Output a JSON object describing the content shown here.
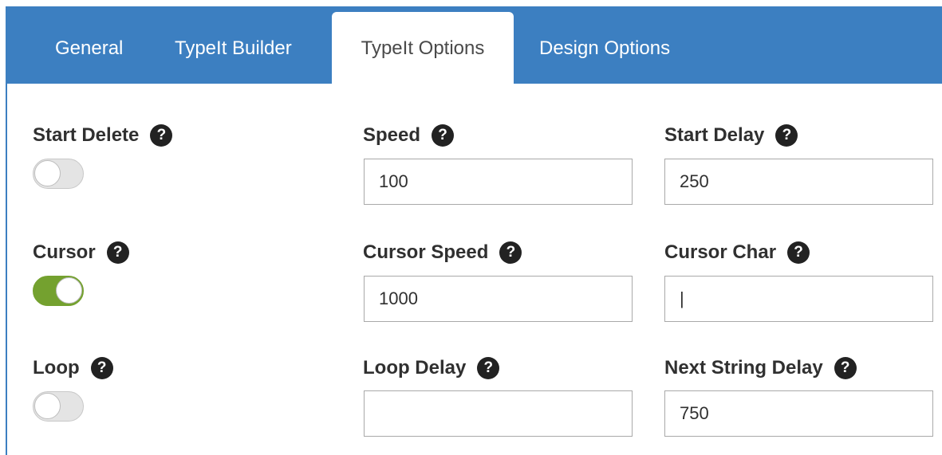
{
  "tabs": [
    {
      "label": "General"
    },
    {
      "label": "TypeIt Builder"
    },
    {
      "label": "TypeIt Options"
    },
    {
      "label": "Design Options"
    }
  ],
  "active_tab": "TypeIt Options",
  "help_glyph": "?",
  "fields": {
    "start_delete": {
      "label": "Start Delete",
      "enabled": false
    },
    "cursor": {
      "label": "Cursor",
      "enabled": true
    },
    "loop": {
      "label": "Loop",
      "enabled": false
    },
    "speed": {
      "label": "Speed",
      "value": "100"
    },
    "start_delay": {
      "label": "Start Delay",
      "value": "250"
    },
    "cursor_speed": {
      "label": "Cursor Speed",
      "value": "1000"
    },
    "cursor_char": {
      "label": "Cursor Char",
      "value": "|"
    },
    "loop_delay": {
      "label": "Loop Delay",
      "value": ""
    },
    "next_string_delay": {
      "label": "Next String Delay",
      "value": "750"
    }
  },
  "colors": {
    "header_blue": "#3c7fc1",
    "toggle_on": "#74a12f",
    "toggle_off": "#e4e4e4",
    "label_text": "#303030"
  },
  "icons": {
    "help": "question-circle-icon"
  }
}
